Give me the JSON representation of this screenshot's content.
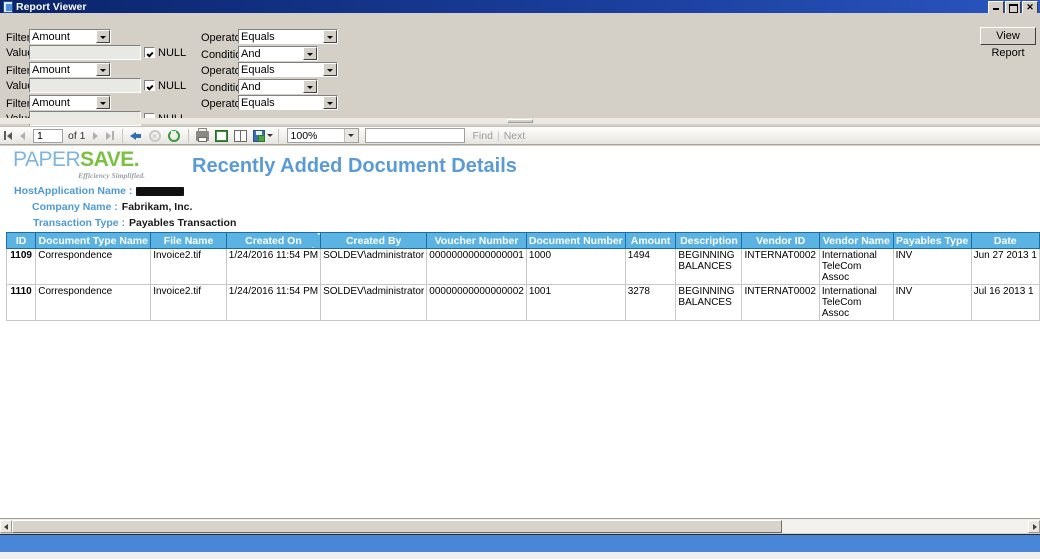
{
  "window": {
    "title": "Report Viewer",
    "icon": "report-viewer-icon",
    "buttons": {
      "minimize": "minimize",
      "restore": "restore",
      "close": "close"
    }
  },
  "params": {
    "view_report_label": "View Report",
    "null_label": "NULL",
    "rows": [
      {
        "filter_label": "Filter",
        "filter_value": "Amount",
        "operator_label": "Operator",
        "operator_value": "Equals",
        "value_label": "Value",
        "value_text": "",
        "condition_label": "Condition",
        "condition_value": "And"
      },
      {
        "filter_label": "Filter",
        "filter_value": "Amount",
        "operator_label": "Operator",
        "operator_value": "Equals",
        "value_label": "Value",
        "value_text": "",
        "condition_label": "Condition",
        "condition_value": "And"
      },
      {
        "filter_label": "Filter",
        "filter_value": "Amount",
        "operator_label": "Operator",
        "operator_value": "Equals",
        "value_label": "Value",
        "value_text": ""
      }
    ]
  },
  "toolbar": {
    "page_current": "1",
    "page_of": "of 1",
    "zoom": "100%",
    "search_value": "",
    "find_label": "Find",
    "next_label": "Next",
    "separator": "|",
    "icons": {
      "first": "first-page-icon",
      "prev": "previous-page-icon",
      "next": "next-page-icon",
      "last": "last-page-icon",
      "back": "back-icon",
      "stop": "stop-icon",
      "refresh": "refresh-icon",
      "print": "print-icon",
      "print_layout": "print-layout-icon",
      "page_setup": "page-setup-icon",
      "export": "export-icon"
    }
  },
  "report": {
    "logo": {
      "paper": "PAPER",
      "save": "SAVE.",
      "tagline": "Efficiency Simplified."
    },
    "title": "Recently Added Document Details",
    "meta": [
      {
        "label": "HostApplication Name :",
        "value": "",
        "redacted": true
      },
      {
        "label": "Company Name :",
        "value": "Fabrikam, Inc.",
        "redacted": false
      },
      {
        "label": "Transaction Type :",
        "value": "Payables Transaction",
        "redacted": false
      }
    ],
    "table": {
      "columns": [
        {
          "key": "id",
          "label": "ID",
          "width": 35,
          "align": "center"
        },
        {
          "key": "doc_type",
          "label": "Document Type Name",
          "width": 112,
          "align": "left"
        },
        {
          "key": "file_name",
          "label": "File Name",
          "width": 159,
          "align": "left"
        },
        {
          "key": "created_on",
          "label": "Created On",
          "width": 78,
          "align": "right",
          "sortable": true
        },
        {
          "key": "created_by",
          "label": "Created By",
          "width": 76,
          "align": "left"
        },
        {
          "key": "voucher_number",
          "label": "Voucher Number",
          "width": 84,
          "align": "left"
        },
        {
          "key": "document_number",
          "label": "Document Number",
          "width": 76,
          "align": "left"
        },
        {
          "key": "amount",
          "label": "Amount",
          "width": 71,
          "align": "left"
        },
        {
          "key": "description",
          "label": "Description",
          "width": 75,
          "align": "left"
        },
        {
          "key": "vendor_id",
          "label": "Vendor ID",
          "width": 76,
          "align": "left"
        },
        {
          "key": "vendor_name",
          "label": "Vendor Name",
          "width": 76,
          "align": "left"
        },
        {
          "key": "payables_type",
          "label": "Payables Type",
          "width": 76,
          "align": "left"
        },
        {
          "key": "date",
          "label": "Date",
          "width": 55,
          "align": "left"
        }
      ],
      "rows": [
        {
          "id": "1109",
          "doc_type": "Correspondence",
          "file_name": "Invoice2.tif",
          "created_on": "1/24/2016 11:54 PM",
          "created_by": "SOLDEV\\administrator",
          "voucher_number": "00000000000000001",
          "document_number": "1000",
          "amount": "1494",
          "description": "BEGINNING BALANCES",
          "vendor_id": "INTERNAT0002",
          "vendor_name": "International TeleCom Assoc",
          "payables_type": "INV",
          "date": "Jun 27 2013 1"
        },
        {
          "id": "1110",
          "doc_type": "Correspondence",
          "file_name": "Invoice2.tif",
          "created_on": "1/24/2016 11:54 PM",
          "created_by": "SOLDEV\\administrator",
          "voucher_number": "00000000000000002",
          "document_number": "1001",
          "amount": "3278",
          "description": "BEGINNING BALANCES",
          "vendor_id": "INTERNAT0002",
          "vendor_name": "International TeleCom Assoc",
          "payables_type": "INV",
          "date": "Jul 16 2013 1"
        }
      ]
    }
  },
  "colors": {
    "titlebar": "#0a246a",
    "header_blue": "#5bb3e4",
    "report_title": "#5b9bd5",
    "meta_label": "#4d9ad6",
    "logo_paper": "#7fb4dd",
    "logo_save": "#7ac143",
    "status_bar": "#4a86d8",
    "link": "#2a5db0"
  }
}
